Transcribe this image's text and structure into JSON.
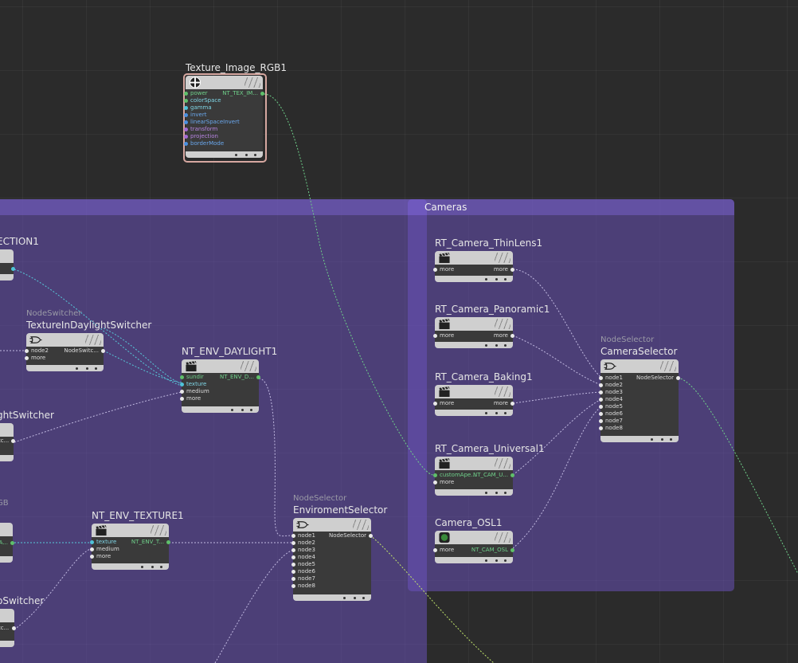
{
  "network_boxes": {
    "cameras": "Cameras"
  },
  "nodes": {
    "texture_image_rgb1": {
      "title": "Texture_Image_RGB1",
      "inputs": [
        "power",
        "colorSpace",
        "gamma",
        "invert",
        "linearSpaceInvert",
        "transform",
        "projection",
        "borderMode"
      ],
      "output": "NT_TEX_IM..."
    },
    "section1": {
      "title": "ECTION1"
    },
    "texture_in_daylight_switcher": {
      "type": "NodeSwitcher",
      "title": "TextureInDaylightSwitcher",
      "inputs": [
        "node2",
        "more"
      ],
      "output": "NodeSwitc..."
    },
    "nt_env_daylight1": {
      "title": "NT_ENV_DAYLIGHT1",
      "inputs": [
        "sundir",
        "texture",
        "medium",
        "more"
      ],
      "output": "NT_ENV_D..."
    },
    "light_switcher": {
      "title": "ghtSwitcher",
      "input_value": "tc..."
    },
    "rgb_fragment": {
      "type": "GB",
      "output": "A..."
    },
    "nt_env_texture1": {
      "title": "NT_ENV_TEXTURE1",
      "inputs": [
        "texture",
        "medium",
        "more"
      ],
      "output": "NT_ENV_T..."
    },
    "o_switcher": {
      "title": "oSwitcher",
      "input_value": "tc..."
    },
    "enviroment_selector": {
      "type": "NodeSelector",
      "title": "EnviromentSelector",
      "inputs": [
        "node1",
        "node2",
        "node3",
        "node4",
        "node5",
        "node6",
        "node7",
        "node8"
      ],
      "output": "NodeSelector"
    },
    "rt_camera_thinlens1": {
      "title": "RT_Camera_ThinLens1",
      "input": "more",
      "output": "more"
    },
    "rt_camera_panoramic1": {
      "title": "RT_Camera_Panoramic1",
      "input": "more",
      "output": "more"
    },
    "rt_camera_baking1": {
      "title": "RT_Camera_Baking1",
      "input": "more",
      "output": "more"
    },
    "rt_camera_universal1": {
      "title": "RT_Camera_Universal1",
      "inputs": [
        "customApe...",
        "more"
      ],
      "output": "NT_CAM_U..."
    },
    "camera_osl1": {
      "title": "Camera_OSL1",
      "input": "more",
      "output": "NT_CAM_OSL"
    },
    "camera_selector": {
      "type": "NodeSelector",
      "title": "CameraSelector",
      "inputs": [
        "node1",
        "node2",
        "node3",
        "node4",
        "node5",
        "node6",
        "node7",
        "node8"
      ],
      "output": "NodeSelector"
    }
  },
  "colors": {
    "background": "#2b2b2b",
    "network_box": "#5e4aa6",
    "wire": "#b9b4d6",
    "selected_outline": "#d6a7a0",
    "port_green": "#5fbf6a",
    "port_cyan": "#4fc3d9",
    "port_blue": "#4a90e2",
    "port_purple": "#a36ad6"
  },
  "icons": {
    "texture_image_rgb1": "checker-ball-icon",
    "env_nodes": "clapperboard-icon",
    "cameras": "clapperboard-icon",
    "camera_osl1": "osl-chip-icon",
    "switchers": "logic-gate-icon"
  }
}
